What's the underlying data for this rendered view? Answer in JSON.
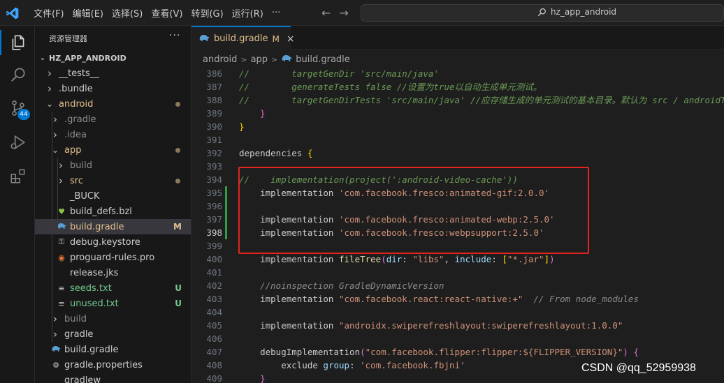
{
  "titlebar": {
    "menu": [
      "文件(F)",
      "编辑(E)",
      "选择(S)",
      "查看(V)",
      "转到(G)",
      "运行(R)",
      "···"
    ],
    "search_text": "hz_app_android"
  },
  "activity": {
    "scm_badge": "44"
  },
  "sidebar": {
    "title": "资源管理器",
    "more": "···",
    "root": "HZ_APP_ANDROID",
    "items": [
      {
        "label": "__tests__",
        "depth": 0,
        "kind": "folder",
        "open": false,
        "color": "#cccccc"
      },
      {
        "label": ".bundle",
        "depth": 0,
        "kind": "folder",
        "open": false,
        "color": "#cccccc"
      },
      {
        "label": "android",
        "depth": 0,
        "kind": "folder",
        "open": true,
        "color": "#e2c08d",
        "dot": true
      },
      {
        "label": ".gradle",
        "depth": 1,
        "kind": "folder",
        "open": false,
        "color": "#8c8c8c"
      },
      {
        "label": ".idea",
        "depth": 1,
        "kind": "folder",
        "open": false,
        "color": "#8c8c8c"
      },
      {
        "label": "app",
        "depth": 1,
        "kind": "folder",
        "open": true,
        "color": "#e2c08d",
        "dot": true
      },
      {
        "label": "build",
        "depth": 2,
        "kind": "folder",
        "open": false,
        "color": "#8c8c8c"
      },
      {
        "label": "src",
        "depth": 2,
        "kind": "folder",
        "open": false,
        "color": "#e2c08d",
        "dot": true
      },
      {
        "label": "_BUCK",
        "depth": 2,
        "kind": "file",
        "icon": "",
        "color": "#cccccc"
      },
      {
        "label": "build_defs.bzl",
        "depth": 2,
        "kind": "file",
        "icon": "heart",
        "color": "#cccccc"
      },
      {
        "label": "build.gradle",
        "depth": 2,
        "kind": "file",
        "icon": "gradle",
        "color": "#e2c08d",
        "decor": "M",
        "selected": true
      },
      {
        "label": "debug.keystore",
        "depth": 2,
        "kind": "file",
        "icon": "key",
        "color": "#cccccc"
      },
      {
        "label": "proguard-rules.pro",
        "depth": 2,
        "kind": "file",
        "icon": "pro",
        "color": "#cccccc"
      },
      {
        "label": "release.jks",
        "depth": 2,
        "kind": "file",
        "icon": "",
        "color": "#cccccc"
      },
      {
        "label": "seeds.txt",
        "depth": 2,
        "kind": "file",
        "icon": "txt",
        "color": "#73c991",
        "decor": "U"
      },
      {
        "label": "unused.txt",
        "depth": 2,
        "kind": "file",
        "icon": "txt",
        "color": "#73c991",
        "decor": "U"
      },
      {
        "label": "build",
        "depth": 1,
        "kind": "folder",
        "open": false,
        "color": "#8c8c8c"
      },
      {
        "label": "gradle",
        "depth": 1,
        "kind": "folder",
        "open": false,
        "color": "#cccccc"
      },
      {
        "label": "build.gradle",
        "depth": 1,
        "kind": "file",
        "icon": "gradle",
        "color": "#cccccc"
      },
      {
        "label": "gradle.properties",
        "depth": 1,
        "kind": "file",
        "icon": "gear",
        "color": "#cccccc"
      },
      {
        "label": "gradlew",
        "depth": 1,
        "kind": "file",
        "icon": "",
        "color": "#cccccc"
      }
    ]
  },
  "editor": {
    "tab": {
      "name": "build.gradle",
      "status": "M",
      "close": "×"
    },
    "breadcrumb": [
      "android",
      "app",
      "build.gradle"
    ],
    "current_line": 398,
    "lines": [
      {
        "n": 386,
        "t": [
          [
            "//        targetGenDir 'src/main/java'",
            "c-cm"
          ]
        ]
      },
      {
        "n": 387,
        "t": [
          [
            "//        generateTests false //设置为true以自动生成单元测试。",
            "c-cm"
          ]
        ]
      },
      {
        "n": 388,
        "t": [
          [
            "//        targetGenDirTests 'src/main/java' //应存储生成的单元测试的基本目录。默认为 src / androidTest / java",
            "c-cm"
          ]
        ]
      },
      {
        "n": 389,
        "t": [
          [
            "    ",
            "c-id"
          ],
          [
            "}",
            "c-br"
          ]
        ]
      },
      {
        "n": 390,
        "t": [
          [
            "}",
            "c-br2"
          ]
        ]
      },
      {
        "n": 391,
        "t": []
      },
      {
        "n": 392,
        "t": [
          [
            "dependencies ",
            "c-id"
          ],
          [
            "{",
            "c-br2"
          ]
        ]
      },
      {
        "n": 393,
        "t": []
      },
      {
        "n": 394,
        "t": [
          [
            "//    implementation(project(':android-video-cache'))",
            "c-cm"
          ]
        ]
      },
      {
        "n": 395,
        "t": [
          [
            "    implementation ",
            "c-id"
          ],
          [
            "'com.facebook.fresco:animated-gif:2.0.0'",
            "c-str"
          ]
        ],
        "git": true
      },
      {
        "n": 396,
        "t": [],
        "git": true
      },
      {
        "n": 397,
        "t": [
          [
            "    implementation ",
            "c-id"
          ],
          [
            "'com.facebook.fresco:animated-webp:2.5.0'",
            "c-str"
          ]
        ],
        "git": true
      },
      {
        "n": 398,
        "t": [
          [
            "    implementation ",
            "c-id"
          ],
          [
            "'com.facebook.fresco:webpsupport:2.5.0'",
            "c-str"
          ]
        ],
        "git": true
      },
      {
        "n": 399,
        "t": []
      },
      {
        "n": 400,
        "t": [
          [
            "    implementation ",
            "c-id"
          ],
          [
            "fileTree",
            "c-fn"
          ],
          [
            "(",
            "c-br"
          ],
          [
            "dir",
            "c-prm"
          ],
          [
            ": ",
            "c-id"
          ],
          [
            "\"libs\"",
            "c-str"
          ],
          [
            ", ",
            "c-id"
          ],
          [
            "include",
            "c-prm"
          ],
          [
            ": ",
            "c-id"
          ],
          [
            "[",
            "c-br2"
          ],
          [
            "\"*.jar\"",
            "c-str"
          ],
          [
            "]",
            "c-br2"
          ],
          [
            ")",
            "c-br"
          ]
        ]
      },
      {
        "n": 401,
        "t": []
      },
      {
        "n": 402,
        "t": [
          [
            "    //noinspection GradleDynamicVersion",
            "c-cmt"
          ]
        ]
      },
      {
        "n": 403,
        "t": [
          [
            "    implementation ",
            "c-id"
          ],
          [
            "\"com.facebook.react:react-native:+\"",
            "c-str"
          ],
          [
            "  // From node_modules",
            "c-cmt"
          ]
        ]
      },
      {
        "n": 404,
        "t": []
      },
      {
        "n": 405,
        "t": [
          [
            "    implementation ",
            "c-id"
          ],
          [
            "\"androidx.swiperefreshlayout:swiperefreshlayout:1.0.0\"",
            "c-str"
          ]
        ]
      },
      {
        "n": 406,
        "t": []
      },
      {
        "n": 407,
        "t": [
          [
            "    debugImplementation",
            "c-id"
          ],
          [
            "(",
            "c-br"
          ],
          [
            "\"com.facebook.flipper:flipper:${FLIPPER_VERSION}\"",
            "c-str"
          ],
          [
            ") ",
            "c-br"
          ],
          [
            "{",
            "c-br"
          ]
        ]
      },
      {
        "n": 408,
        "t": [
          [
            "        exclude ",
            "c-id"
          ],
          [
            "group",
            "c-prm"
          ],
          [
            ": ",
            "c-id"
          ],
          [
            "'com.facebook.fbjni'",
            "c-str"
          ]
        ]
      },
      {
        "n": 409,
        "t": [
          [
            "    ",
            "c-id"
          ],
          [
            "}",
            "c-br"
          ]
        ]
      }
    ]
  },
  "watermark": "CSDN @qq_52959938"
}
